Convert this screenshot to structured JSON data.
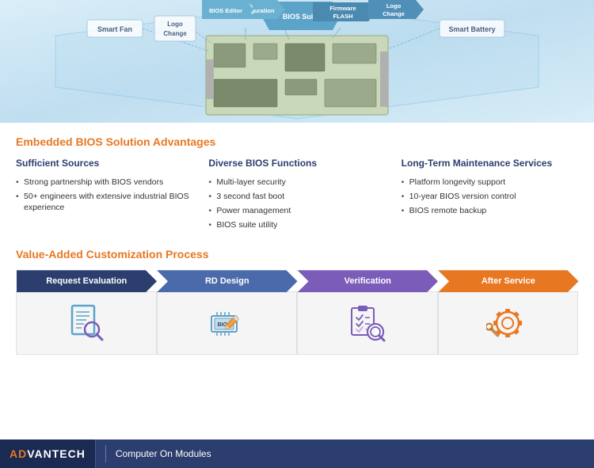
{
  "hero": {
    "labels": {
      "smart_fan": "Smart Fan",
      "logo_change_left": "Logo Change",
      "bios_editor": "BIOS Editor",
      "config_tools": "Configuration Tools",
      "firmware_flash": "Firmware FLASH",
      "logo_change_right": "Logo Change",
      "bios_suite": "BIOS Suite",
      "smart_battery": "Smart Battery"
    }
  },
  "section1": {
    "title": "Embedded BIOS Solution Advantages",
    "col1": {
      "title": "Sufficient Sources",
      "items": [
        "Strong partnership with BIOS vendors",
        "50+ engineers with extensive industrial BIOS experience"
      ]
    },
    "col2": {
      "title": "Diverse BIOS Functions",
      "items": [
        "Multi-layer security",
        "3 second fast boot",
        "Power management",
        "BIOS suite utility"
      ]
    },
    "col3": {
      "title": "Long-Term Maintenance Services",
      "items": [
        "Platform longevity support",
        "10-year BIOS version control",
        "BIOS remote backup"
      ]
    }
  },
  "section2": {
    "title": "Value-Added Customization Process",
    "steps": [
      {
        "label": "Request Evaluation",
        "color": "dark-blue"
      },
      {
        "label": "RD Design",
        "color": "medium-blue"
      },
      {
        "label": "Verification",
        "color": "purple"
      },
      {
        "label": "After Service",
        "color": "orange"
      }
    ]
  },
  "footer": {
    "brand_ad": "AD",
    "brand_vantech": "VANTECH",
    "divider": "|",
    "subtitle": "Computer On Modules"
  }
}
